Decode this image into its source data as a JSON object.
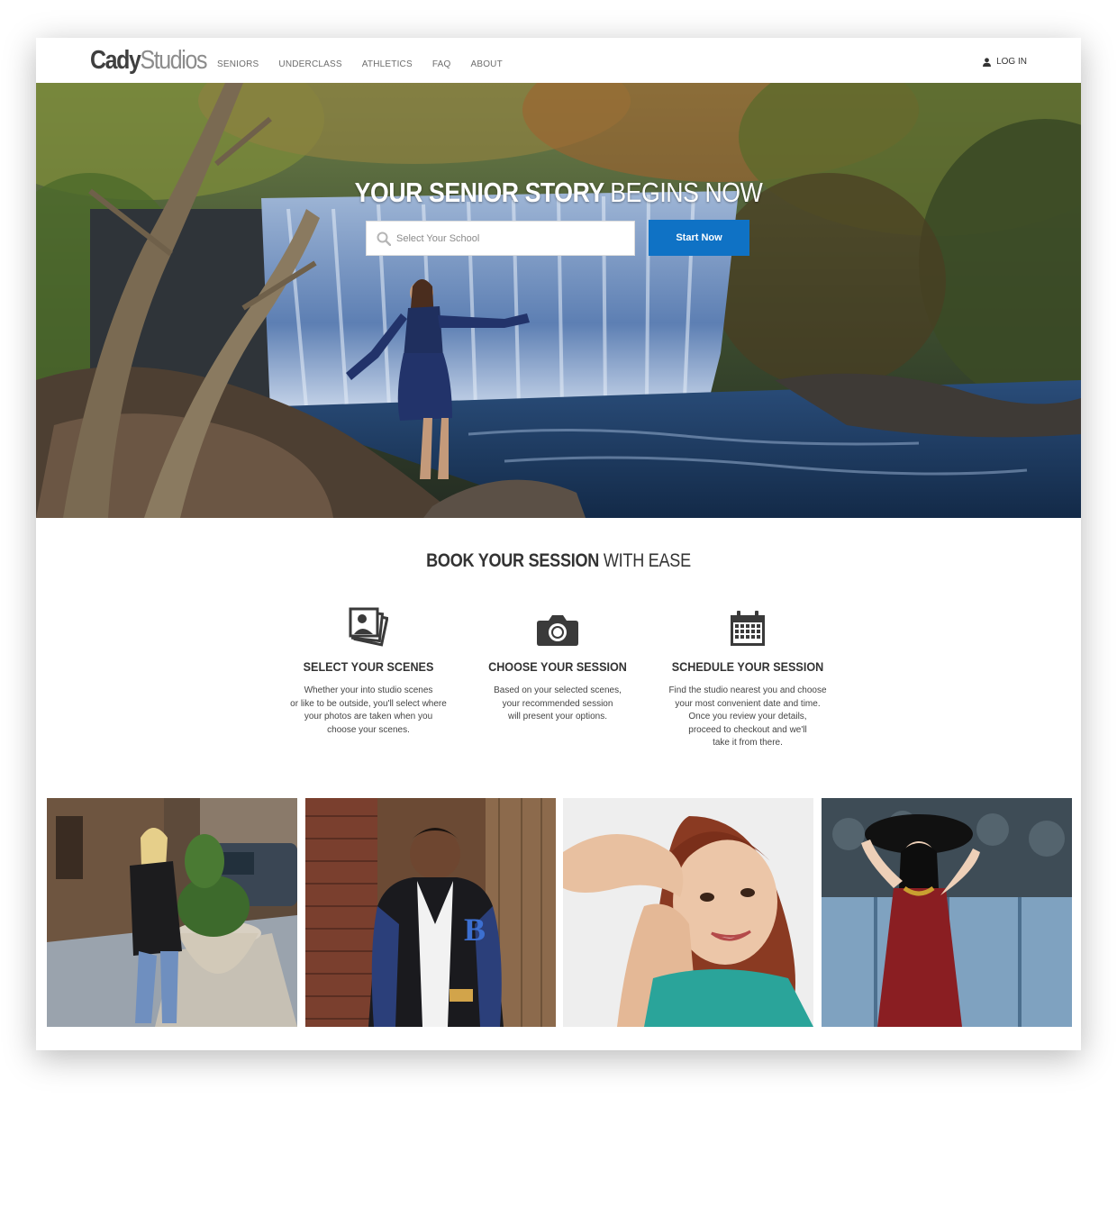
{
  "brand": {
    "name_bold": "Cady",
    "name_light": "Studios"
  },
  "nav": {
    "items": [
      {
        "label": "SENIORS"
      },
      {
        "label": "UNDERCLASS"
      },
      {
        "label": "ATHLETICS"
      },
      {
        "label": "FAQ"
      },
      {
        "label": "ABOUT"
      }
    ]
  },
  "header": {
    "login_label": "LOG IN",
    "login_icon": "user-icon"
  },
  "hero": {
    "title_bold": "YOUR SENIOR STORY",
    "title_light": "BEGINS NOW",
    "search": {
      "placeholder": "Select Your School",
      "value": "",
      "icon": "search-icon"
    },
    "cta_label": "Start Now"
  },
  "booking": {
    "title_bold": "BOOK YOUR SESSION",
    "title_light": "WITH EASE",
    "steps": [
      {
        "icon": "photos-icon",
        "title": "SELECT YOUR SCENES",
        "lines": [
          "Whether your into studio scenes",
          "or like to be outside, you'll select where",
          "your photos are taken when you",
          "choose your scenes."
        ]
      },
      {
        "icon": "camera-icon",
        "title": "CHOOSE YOUR SESSION",
        "lines": [
          "Based on your selected scenes,",
          "your recommended session",
          "will present your options."
        ]
      },
      {
        "icon": "calendar-icon",
        "title": "SCHEDULE YOUR SESSION",
        "lines": [
          "Find the studio nearest you and choose",
          "your most convenient date and time.",
          "Once you review your details,",
          "proceed to checkout and we'll",
          "take it from there."
        ]
      }
    ]
  },
  "colors": {
    "accent": "#0f72c5",
    "text_dark": "#333333",
    "nav_gray": "#6d6d6d"
  }
}
